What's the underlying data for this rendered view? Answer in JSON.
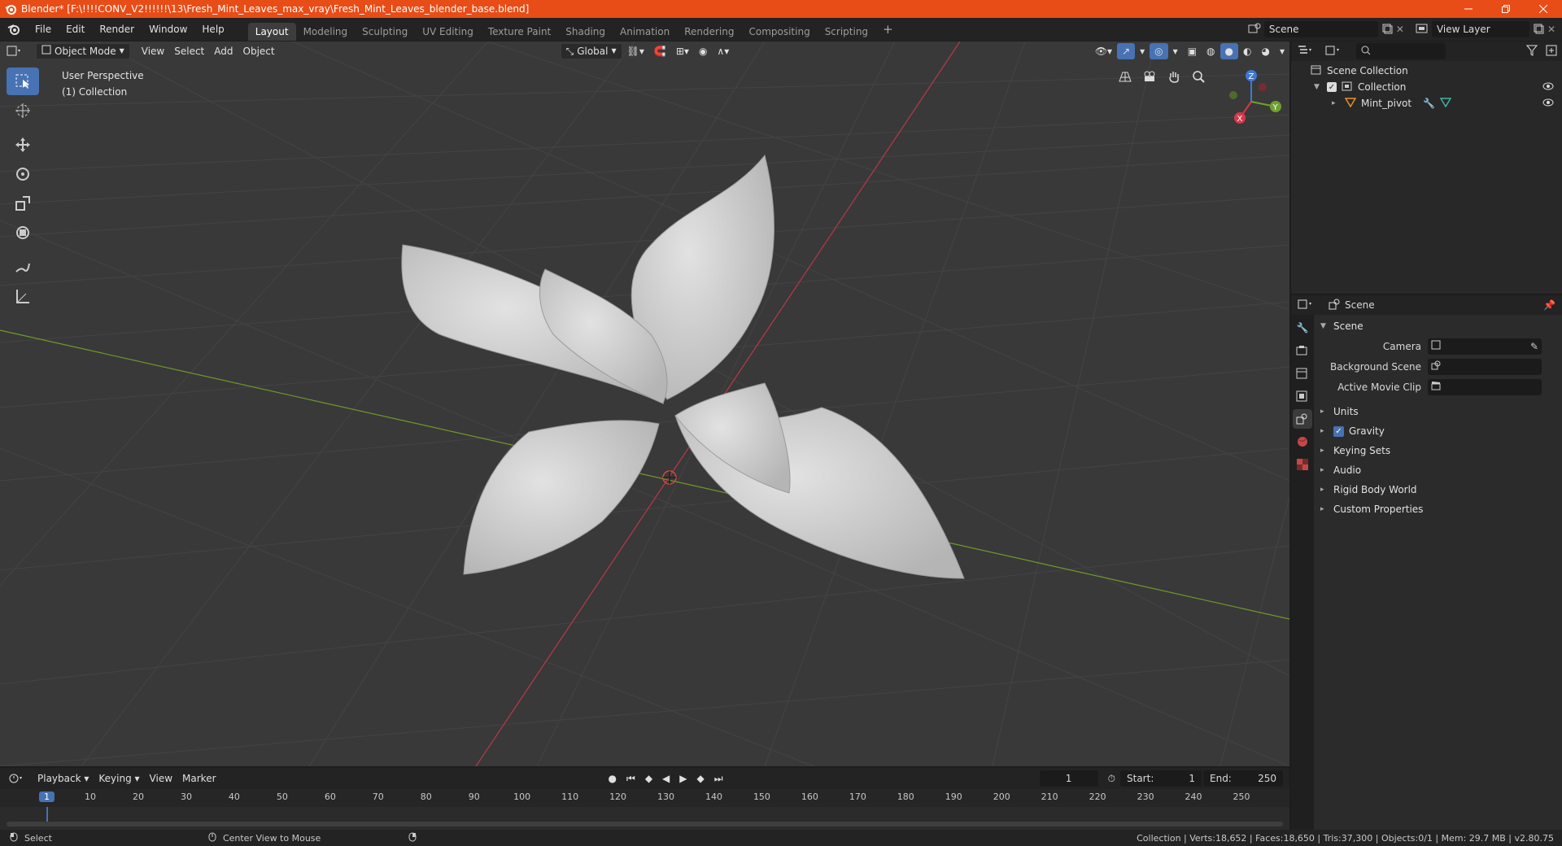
{
  "titlebar": {
    "title": "Blender* [F:\\!!!!CONV_V2!!!!!!\\13\\Fresh_Mint_Leaves_max_vray\\Fresh_Mint_Leaves_blender_base.blend]",
    "accent": "#e84c17"
  },
  "menus": [
    "File",
    "Edit",
    "Render",
    "Window",
    "Help"
  ],
  "workspaces": [
    "Layout",
    "Modeling",
    "Sculpting",
    "UV Editing",
    "Texture Paint",
    "Shading",
    "Animation",
    "Rendering",
    "Compositing",
    "Scripting"
  ],
  "active_workspace": "Layout",
  "scene_field": "Scene",
  "view_layer_field": "View Layer",
  "viewport": {
    "mode": "Object Mode",
    "menus": [
      "View",
      "Select",
      "Add",
      "Object"
    ],
    "orientation": "Global",
    "info_line1": "User Perspective",
    "info_line2": "(1) Collection",
    "active_tool": "select-box",
    "gizmo_labels": {
      "z": "Z",
      "y": "Y",
      "x": "X"
    }
  },
  "timeline": {
    "menus": [
      "Playback",
      "Keying",
      "View",
      "Marker"
    ],
    "current_frame": "1",
    "start_label": "Start:",
    "start": "1",
    "end_label": "End:",
    "end": "250",
    "ruler": [
      "1",
      "10",
      "20",
      "30",
      "40",
      "50",
      "60",
      "70",
      "80",
      "90",
      "100",
      "110",
      "120",
      "130",
      "140",
      "150",
      "160",
      "170",
      "180",
      "190",
      "200",
      "210",
      "220",
      "230",
      "240",
      "250"
    ]
  },
  "outliner": {
    "root": "Scene Collection",
    "collection": "Collection",
    "object": "Mint_pivot"
  },
  "properties": {
    "header": "Scene",
    "section": "Scene",
    "camera_label": "Camera",
    "background_label": "Background Scene",
    "movieclip_label": "Active Movie Clip",
    "subsections": [
      "Units",
      "Gravity",
      "Keying Sets",
      "Audio",
      "Rigid Body World",
      "Custom Properties"
    ],
    "gravity_checked": true
  },
  "statusbar": {
    "left1": "Select",
    "left2": "Center View to Mouse",
    "right": "Collection | Verts:18,652 | Faces:18,650 | Tris:37,300 | Objects:0/1 | Mem: 29.7 MB | v2.80.75"
  }
}
